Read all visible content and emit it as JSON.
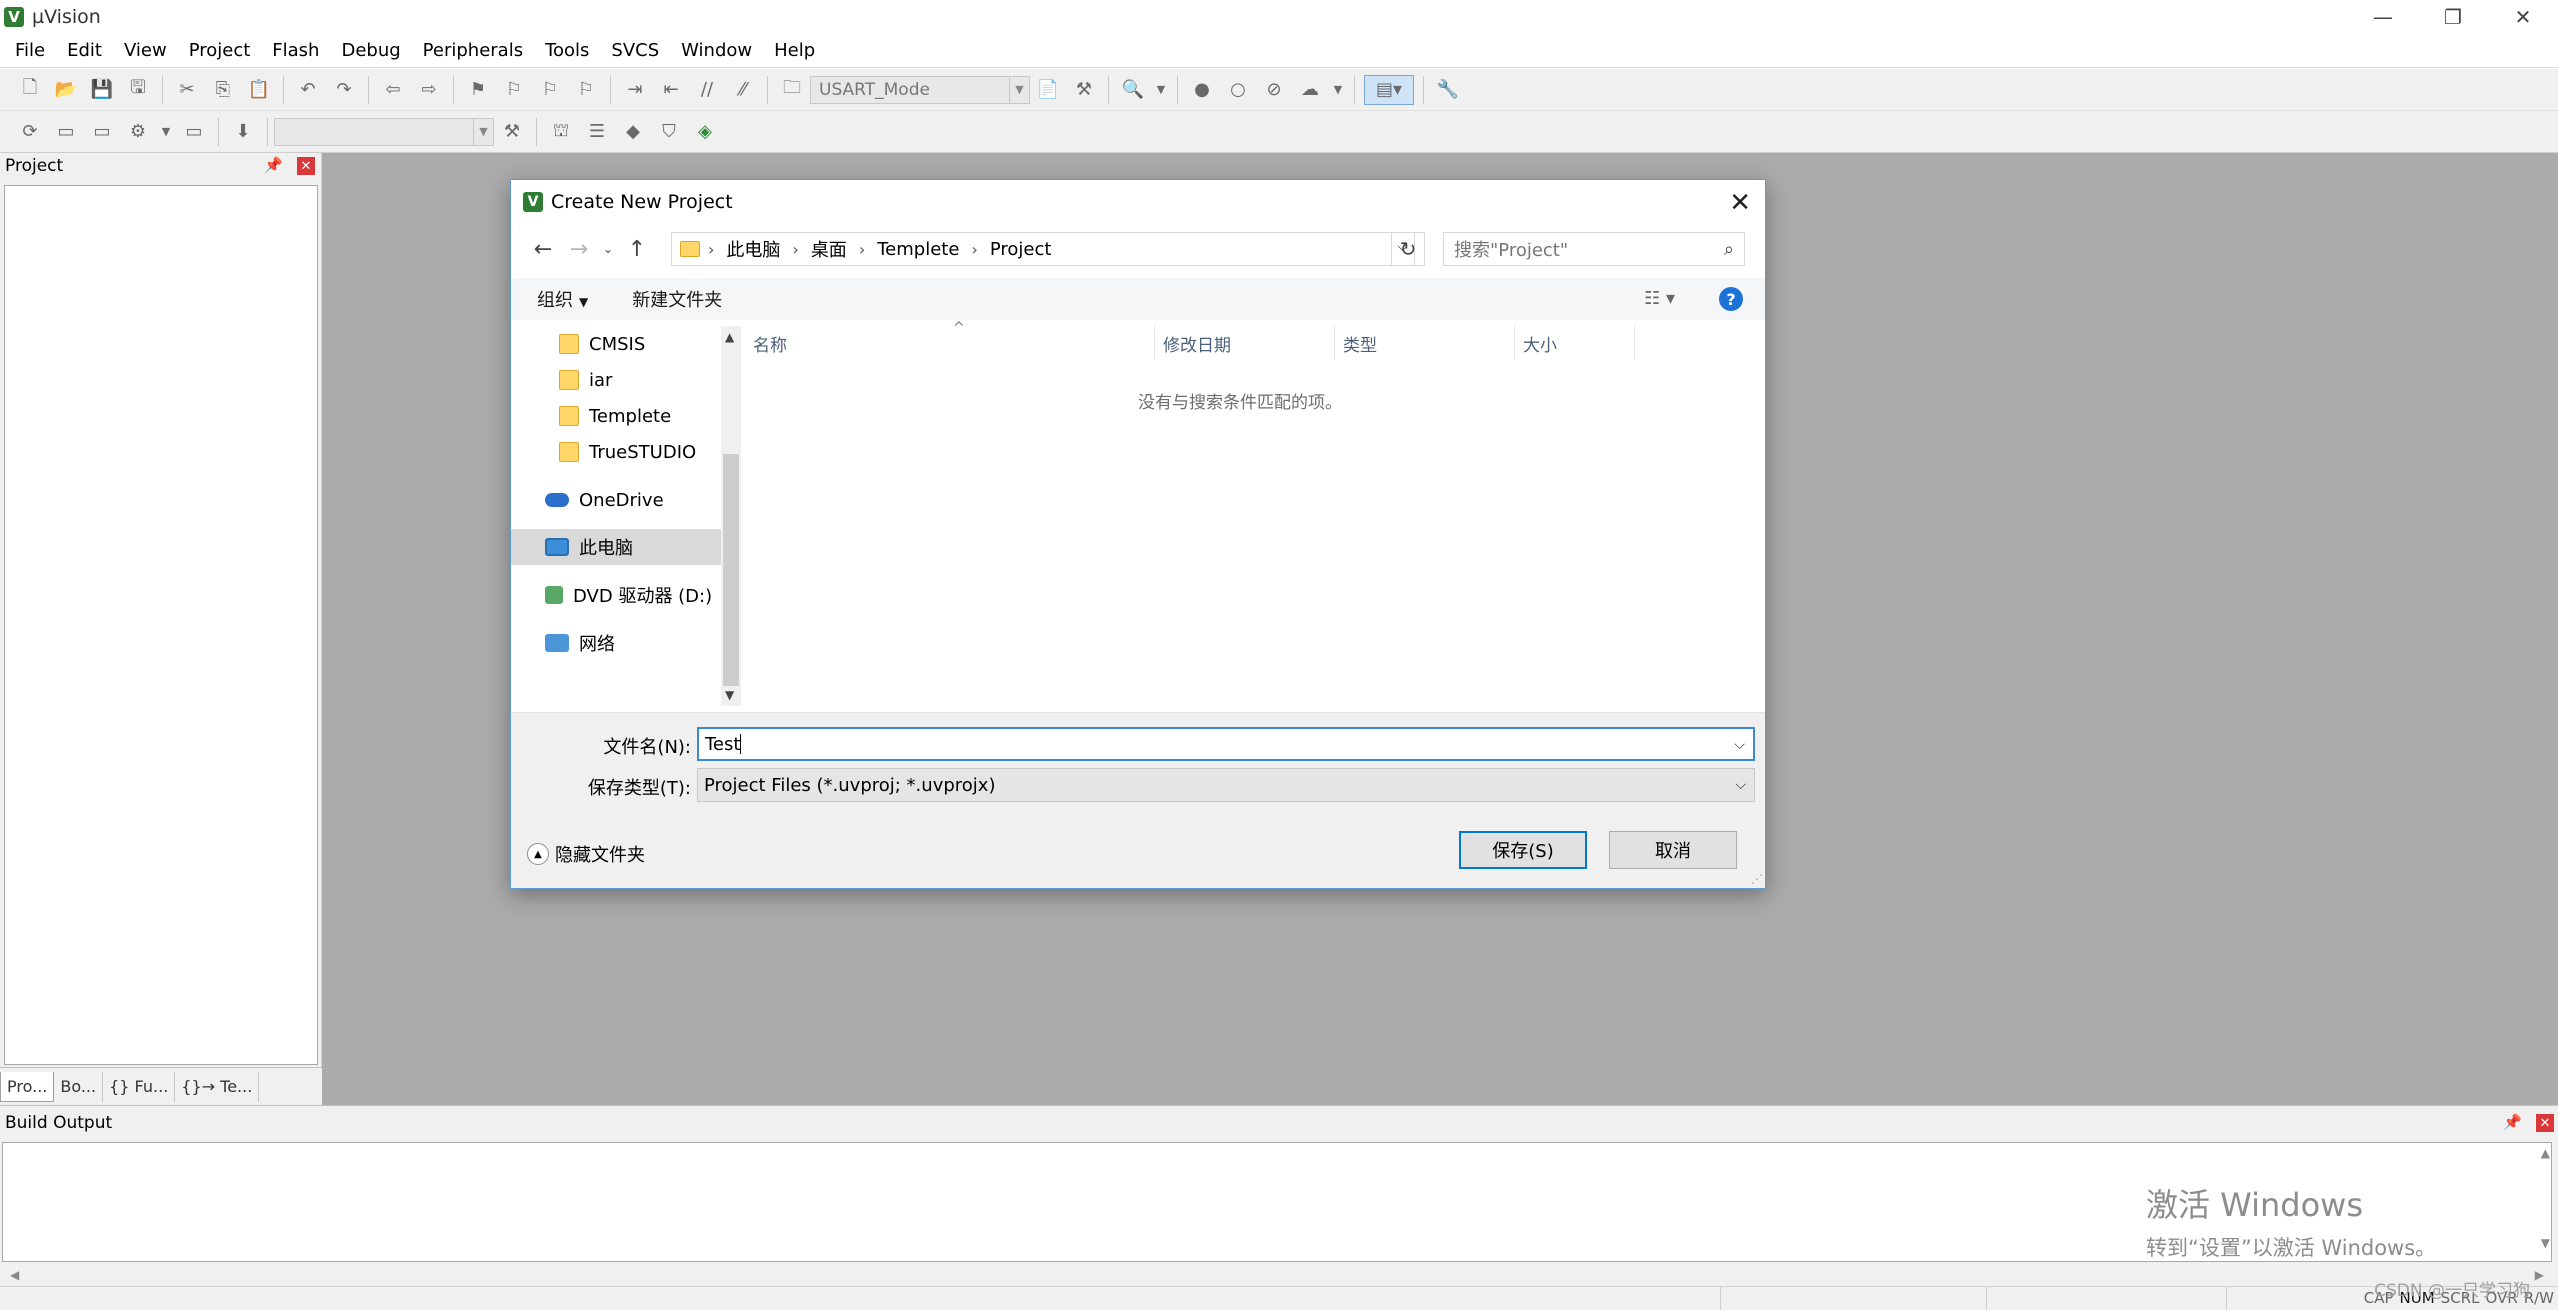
{
  "app": {
    "title": "µVision",
    "icon": "V"
  },
  "window_controls": {
    "minimize": "—",
    "restore": "❐",
    "close": "✕"
  },
  "menu": [
    "File",
    "Edit",
    "View",
    "Project",
    "Flash",
    "Debug",
    "Peripherals",
    "Tools",
    "SVCS",
    "Window",
    "Help"
  ],
  "toolbar": {
    "target_combo": "USART_Mode",
    "target_combo_2": ""
  },
  "project_panel": {
    "title": "Project",
    "tabs": [
      "Pro...",
      "Bo...",
      "{} Fu...",
      "{}→ Te..."
    ]
  },
  "build_output": {
    "title": "Build Output"
  },
  "watermark": {
    "line1": "激活 Windows",
    "line2": "转到“设置”以激活 Windows。"
  },
  "status": {
    "keys": [
      "CAP",
      "NUM",
      "SCRL",
      "OVR",
      "R/W"
    ],
    "csdn": "CSDN @一只学习狗"
  },
  "dialog": {
    "title": "Create New Project",
    "breadcrumb": [
      "此电脑",
      "桌面",
      "Templete",
      "Project"
    ],
    "search_placeholder": "搜索\"Project\"",
    "organize": "组织",
    "new_folder": "新建文件夹",
    "nav_items": [
      {
        "label": "CMSIS",
        "icon": "folder-icon"
      },
      {
        "label": "iar",
        "icon": "folder-icon"
      },
      {
        "label": "Templete",
        "icon": "folder-icon"
      },
      {
        "label": "TrueSTUDIO",
        "icon": "folder-icon"
      },
      {
        "label": "OneDrive",
        "icon": "cloud-icon"
      },
      {
        "label": "此电脑",
        "icon": "computer-icon",
        "selected": true
      },
      {
        "label": "DVD 驱动器 (D:)",
        "icon": "dvd-drive-icon"
      },
      {
        "label": "网络",
        "icon": "network-icon"
      }
    ],
    "columns": [
      "名称",
      "修改日期",
      "类型",
      "大小"
    ],
    "empty_message": "没有与搜索条件匹配的项。",
    "filename_label": "文件名(N):",
    "filename_value": "Test",
    "filetype_label": "保存类型(T):",
    "filetype_value": "Project Files (*.uvproj; *.uvprojx)",
    "hide_folders": "隐藏文件夹",
    "save_button": "保存(S)",
    "cancel_button": "取消"
  }
}
